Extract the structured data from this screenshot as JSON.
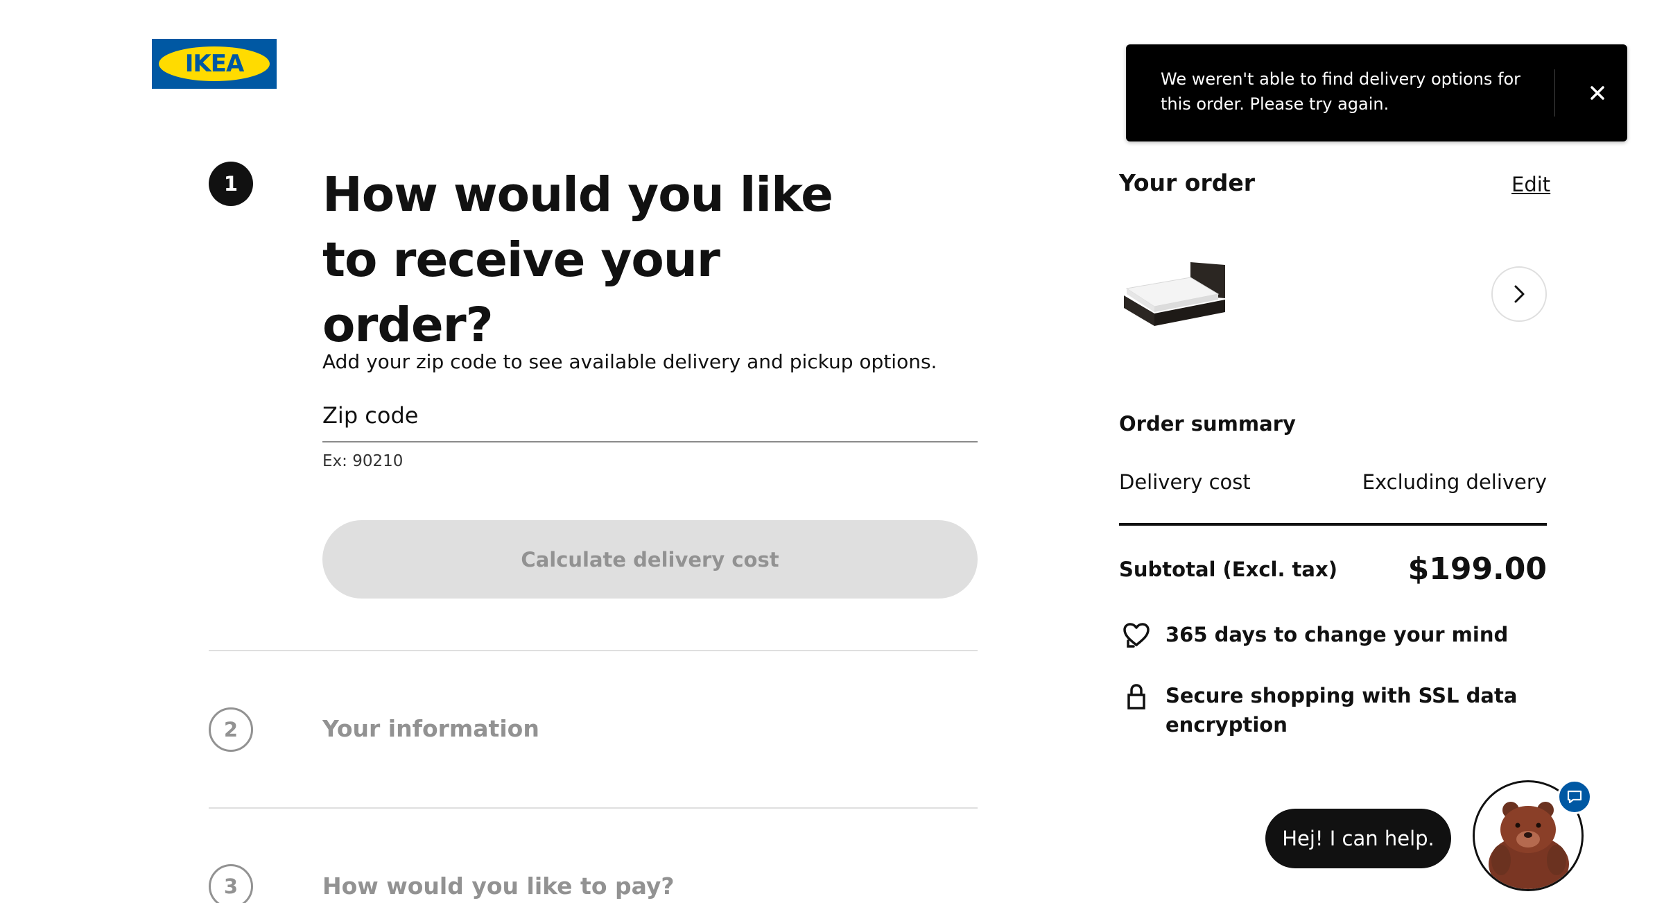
{
  "brand": {
    "logo_text": "IKEA",
    "blue": "#0058a3",
    "yellow": "#ffdb00"
  },
  "steps": [
    {
      "number": "1",
      "title": "How would you like to receive your order?",
      "state": "active"
    },
    {
      "number": "2",
      "title": "Your information",
      "state": "inactive"
    },
    {
      "number": "3",
      "title": "How would you like to pay?",
      "state": "inactive"
    }
  ],
  "delivery": {
    "intro": "Add your zip code to see available delivery and pickup options.",
    "zip_label": "Zip code",
    "zip_value": "",
    "zip_hint": "Ex: 90210",
    "calculate_button": "Calculate delivery cost"
  },
  "toast": {
    "message": "We weren't able to find delivery options for this order. Please try again.",
    "close_icon": "close-icon"
  },
  "order": {
    "title": "Your order",
    "edit_label": "Edit",
    "product_icon": "bed-image",
    "expand_icon": "chevron-right-icon"
  },
  "summary": {
    "title": "Order summary",
    "delivery_label": "Delivery cost",
    "delivery_value": "Excluding delivery",
    "subtotal_label": "Subtotal (Excl. tax)",
    "subtotal_value": "$199.00"
  },
  "features": [
    {
      "icon": "heart-return-icon",
      "text": "365 days to change your mind"
    },
    {
      "icon": "lock-icon",
      "text": "Secure shopping with SSL data encryption"
    }
  ],
  "chat": {
    "bubble_text": "Hej! I can help.",
    "avatar": "bear-avatar",
    "badge_icon": "chat-icon"
  },
  "colors": {
    "text": "#111111",
    "muted": "#929292",
    "disabled_button": "#dfdfdf",
    "toast_bg": "#000000"
  }
}
